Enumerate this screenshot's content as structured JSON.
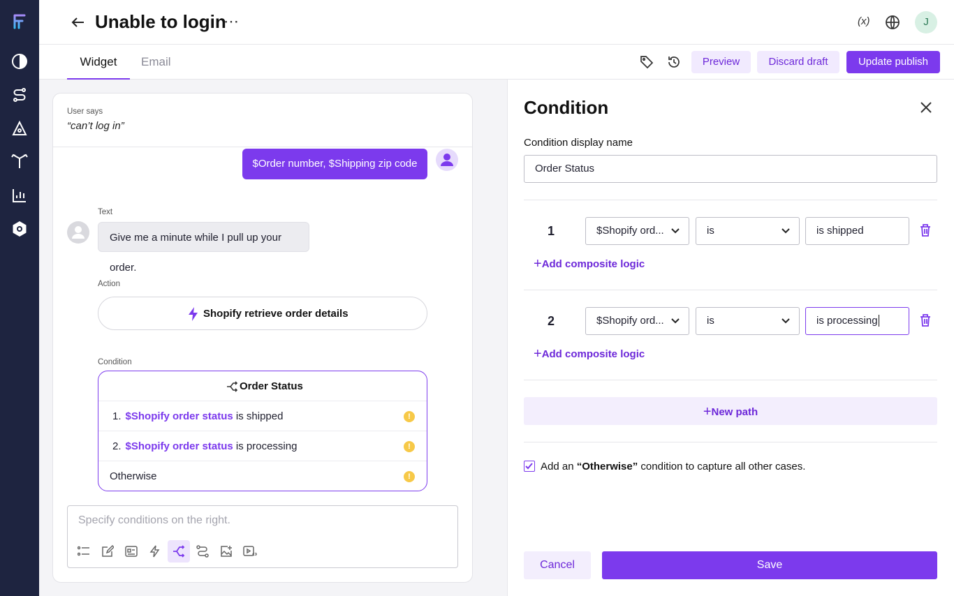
{
  "header": {
    "title": "Unable to login",
    "user_initial": "J",
    "variables_label": "(x)"
  },
  "tabs": [
    "Widget",
    "Email"
  ],
  "toolbar": {
    "preview": "Preview",
    "discard": "Discard draft",
    "publish": "Update publish"
  },
  "flow": {
    "user_says_label": "User says",
    "user_says_text": "“can’t log in”",
    "user_bubble": "$Order number, $Shipping zip code",
    "text_label": "Text",
    "text_message": "Give me a minute while I pull up your order.",
    "action_label": "Action",
    "action_name": "Shopify retrieve order details",
    "condition_label": "Condition",
    "condition_title": "Order Status",
    "rows": [
      {
        "num": "1.",
        "var": "$Shopify order status",
        "value": "is shipped"
      },
      {
        "num": "2.",
        "var": "$Shopify order status",
        "value": "is processing"
      }
    ],
    "otherwise": "Otherwise",
    "input_placeholder": "Specify conditions on the right."
  },
  "panel": {
    "title": "Condition",
    "display_name_label": "Condition display name",
    "display_name_value": "Order Status",
    "conditions": [
      {
        "num": "1",
        "field": "$Shopify ord...",
        "operator": "is",
        "value": "is shipped"
      },
      {
        "num": "2",
        "field": "$Shopify ord...",
        "operator": "is",
        "value": "is processing"
      }
    ],
    "add_composite": "Add composite logic",
    "new_path": "New path",
    "otherwise_pre": "Add an ",
    "otherwise_bold": "“Otherwise”",
    "otherwise_post": " condition to capture all other cases.",
    "otherwise_checked": true,
    "cancel": "Cancel",
    "save": "Save"
  },
  "colors": {
    "accent": "#7c3aed",
    "rail": "#1e2440",
    "warning": "#f7c948"
  }
}
